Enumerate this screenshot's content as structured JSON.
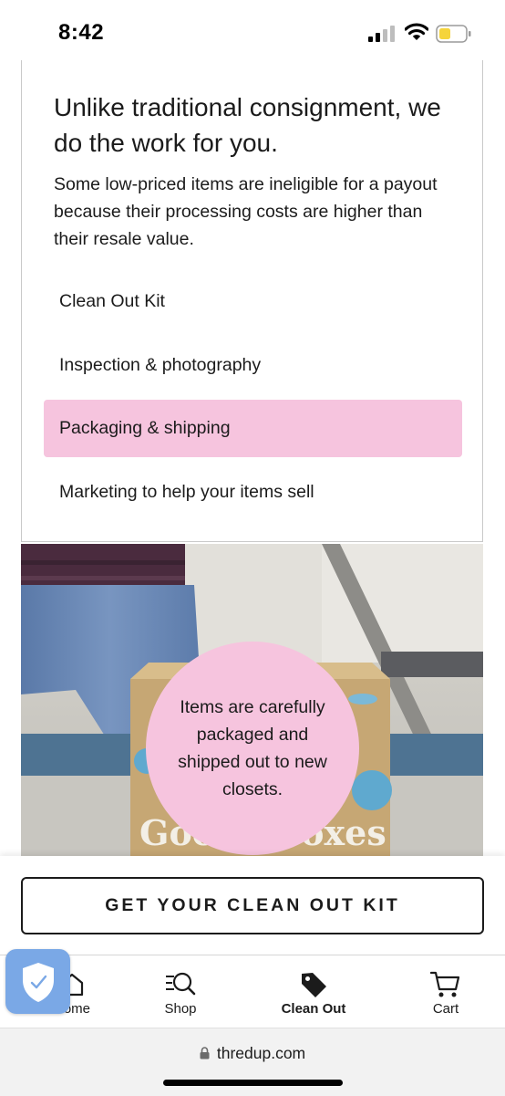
{
  "status_bar": {
    "time": "8:42"
  },
  "feature_card": {
    "heading": "Unlike traditional consignment, we do the work for you.",
    "description": "Some low-priced items are ineligible for a payout because their processing costs are higher than their resale value.",
    "steps": [
      {
        "label": "Clean Out Kit",
        "active": false
      },
      {
        "label": "Inspection & photography",
        "active": false
      },
      {
        "label": "Packaging & shipping",
        "active": true
      },
      {
        "label": "Marketing to help your items sell",
        "active": false
      }
    ]
  },
  "step_detail": {
    "caption": "Items are carefully packaged and shipped out to new closets.",
    "box_print": "Goody Boxes"
  },
  "cta": {
    "label": "GET YOUR CLEAN OUT KIT"
  },
  "tabbar": {
    "items": [
      {
        "label": "Home",
        "icon": "home-icon",
        "active": false
      },
      {
        "label": "Shop",
        "icon": "search-icon",
        "active": false
      },
      {
        "label": "Clean Out",
        "icon": "tag-icon",
        "active": true
      },
      {
        "label": "Cart",
        "icon": "cart-icon",
        "active": false
      }
    ]
  },
  "browser": {
    "url": "thredup.com"
  },
  "colors": {
    "accent_pink": "#f6c4de",
    "text": "#1b1b1b",
    "shield_blue": "#7aa8e6"
  }
}
